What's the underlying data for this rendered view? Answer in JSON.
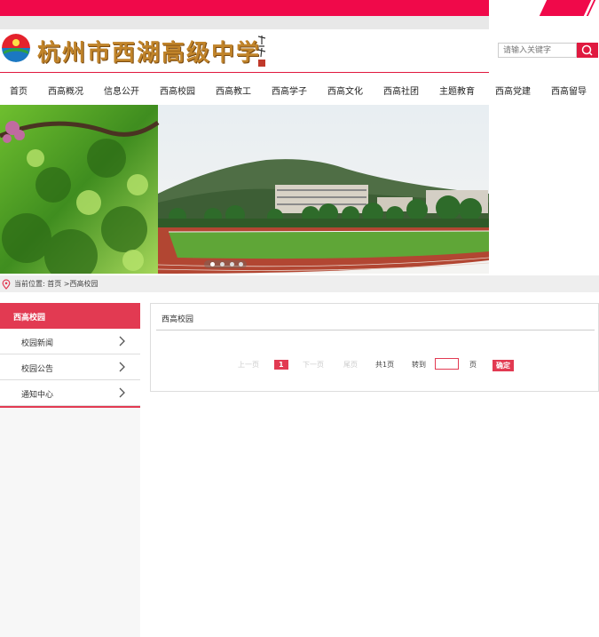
{
  "header": {
    "school_name": "杭州市西湖高级中学",
    "seal_text": "浩宇题",
    "search_placeholder": "请输入关键字"
  },
  "nav": {
    "items": [
      "首页",
      "西高概况",
      "信息公开",
      "西高校园",
      "西高教工",
      "西高学子",
      "西高文化",
      "西高社团",
      "主题教育",
      "西高党建",
      "西高留导"
    ]
  },
  "breadcrumb": {
    "text": "当前位置: 首页 >西高校园"
  },
  "sidebar": {
    "title": "西高校园",
    "items": [
      {
        "label": "校园新闻"
      },
      {
        "label": "校园公告"
      },
      {
        "label": "通知中心"
      }
    ]
  },
  "content": {
    "title": "西高校园",
    "pager": {
      "prev": "上一页",
      "current": "1",
      "next": "下一页",
      "last": "尾页",
      "total": "共1页",
      "goto": "转到",
      "page_unit": "页",
      "confirm": "确定"
    }
  },
  "colors": {
    "brand": "#f0094a",
    "accent": "#e23a52"
  }
}
